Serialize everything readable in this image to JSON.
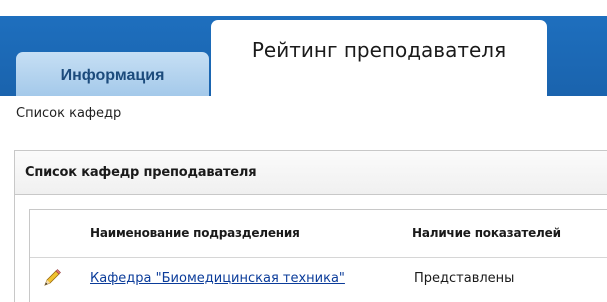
{
  "tabs": [
    {
      "label": "Информация",
      "active": false
    },
    {
      "label": "Рейтинг преподавателя",
      "active": true
    }
  ],
  "breadcrumb": "Список кафедр",
  "panel": {
    "title": "Список кафедр преподавателя",
    "columns": [
      "Наименование подразделения",
      "Наличие показателей"
    ],
    "rows": [
      {
        "name": "Кафедра \"Биомедицинская техника\"",
        "status": "Представлены",
        "icon": "pencil-icon"
      }
    ]
  },
  "colors": {
    "tab_bar": "#1e6fbe",
    "inactive_tab": "#b4d3ef",
    "link": "#0b3c9a"
  }
}
